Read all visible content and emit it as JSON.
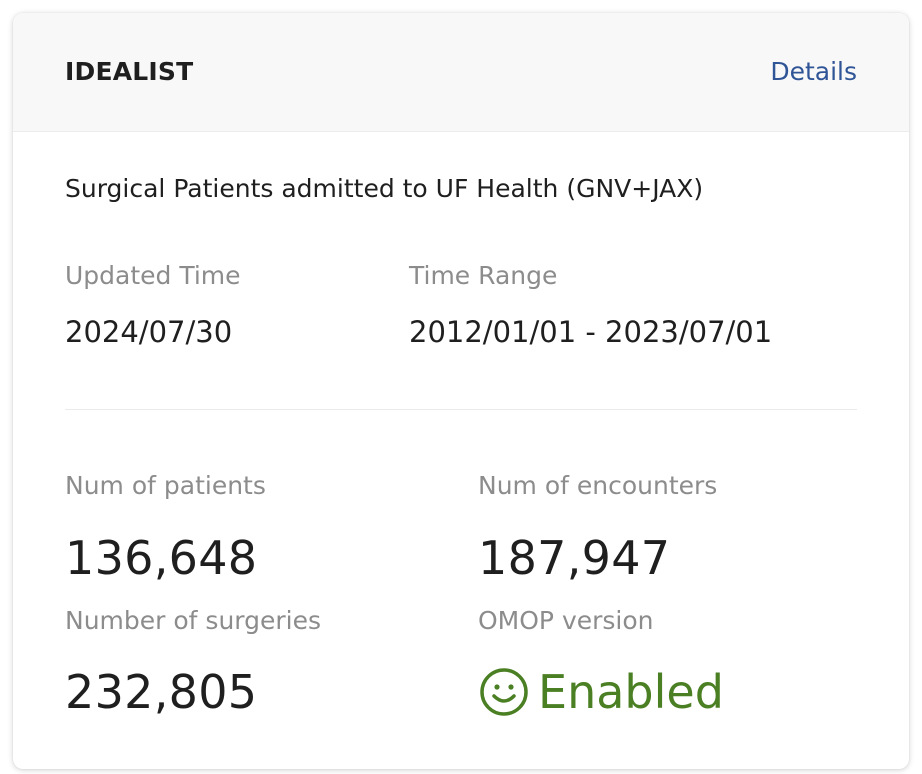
{
  "header": {
    "title": "IDEALIST",
    "details_link": "Details"
  },
  "description": "Surgical Patients admitted to UF Health (GNV+JAX)",
  "meta": {
    "updated_time_label": "Updated Time",
    "updated_time_value": "2024/07/30",
    "time_range_label": "Time Range",
    "time_range_value": "2012/01/01 - 2023/07/01"
  },
  "stats": {
    "patients_label": "Num of patients",
    "patients_value": "136,648",
    "encounters_label": "Num of encounters",
    "encounters_value": "187,947",
    "surgeries_label": "Number of surgeries",
    "surgeries_value": "232,805",
    "omop_label": "OMOP version",
    "omop_value": "Enabled",
    "omop_icon": "smile-icon",
    "omop_color": "#4a7f23"
  },
  "colors": {
    "link": "#2f5597",
    "label": "#8c8c8c",
    "text": "#1f1f1f",
    "header_bg": "#f8f8f8"
  }
}
